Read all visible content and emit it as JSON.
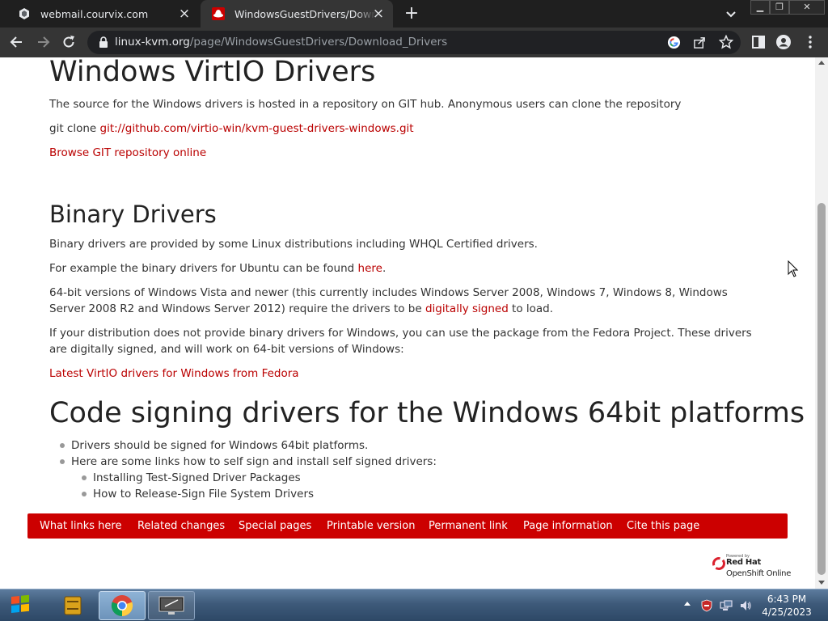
{
  "browser": {
    "tabs": [
      {
        "title": "webmail.courvix.com",
        "active": false
      },
      {
        "title": "WindowsGuestDrivers/Download_Drivers",
        "active": true
      }
    ],
    "url_host": "linux-kvm.org",
    "url_path": "/page/WindowsGuestDrivers/Download_Drivers"
  },
  "page": {
    "section1": {
      "heading": "Windows VirtIO Drivers",
      "intro": "The source for the Windows drivers is hosted in a repository on GIT hub. Anonymous users can clone the repository",
      "clone_prefix": "git clone ",
      "clone_link": "git://github.com/virtio-win/kvm-guest-drivers-windows.git",
      "browse_link": "Browse GIT repository online"
    },
    "section2": {
      "heading": "Binary Drivers",
      "p1": "Binary drivers are provided by some Linux distributions including WHQL Certified drivers.",
      "p2_prefix": "For example the binary drivers for Ubuntu can be found ",
      "p2_link": "here",
      "p2_suffix": ".",
      "p3_prefix": "64-bit versions of Windows Vista and newer (this currently includes Windows Server 2008, Windows 7, Windows 8, Windows Server 2008 R2 and Windows Server 2012) require the drivers to be ",
      "p3_link": "digitally signed",
      "p3_suffix": " to load.",
      "p4": "If your distribution does not provide binary drivers for Windows, you can use the package from the Fedora Project. These drivers are digitally signed, and will work on 64-bit versions of Windows:",
      "fedora_link": "Latest VirtIO drivers for Windows from Fedora"
    },
    "section3": {
      "heading": "Code signing drivers for the Windows 64bit platforms",
      "bullet1": "Drivers should be signed for Windows 64bit platforms.",
      "bullet2": "Here are some links how to self sign and install self signed drivers:",
      "sub1": "Installing Test-Signed Driver Packages",
      "sub2": "How to Release-Sign File System Drivers"
    },
    "footer_links": [
      "What links here",
      "Related changes",
      "Special pages",
      "Printable version",
      "Permanent link",
      "Page information",
      "Cite this page"
    ],
    "powered_by": {
      "line1": "Powered by",
      "line2": "Red Hat",
      "line3": "OpenShift Online"
    }
  },
  "taskbar": {
    "time": "6:43 PM",
    "date": "4/25/2023"
  },
  "colors": {
    "link": "#ba0000",
    "footer_bar": "#cc0000",
    "chrome_dark": "#1f1f1f",
    "toolbar": "#353535"
  }
}
